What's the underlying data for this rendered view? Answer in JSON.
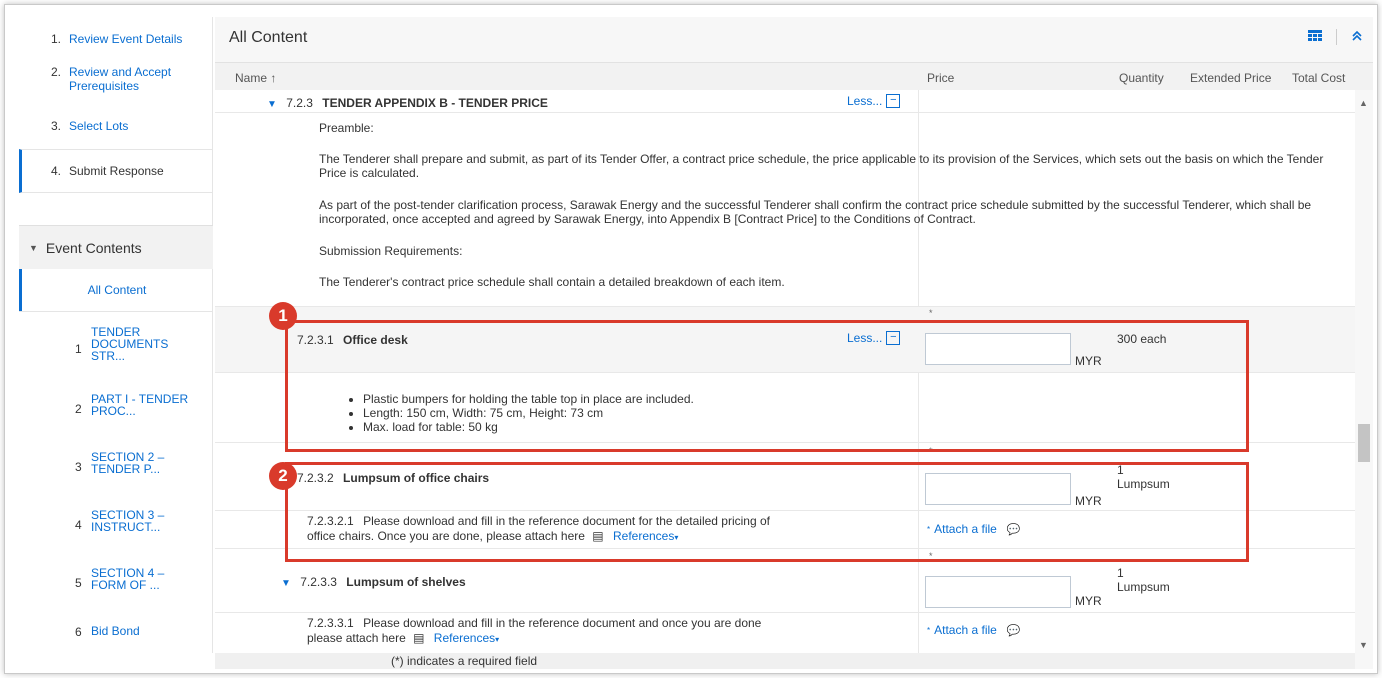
{
  "sidebar": {
    "steps": [
      {
        "num": "1.",
        "label": "Review Event Details"
      },
      {
        "num": "2.",
        "label": "Review and Accept Prerequisites"
      },
      {
        "num": "3.",
        "label": "Select Lots"
      },
      {
        "num": "4.",
        "label": "Submit Response"
      }
    ],
    "event_contents_label": "Event Contents",
    "all_content_label": "All Content",
    "items": [
      {
        "num": "1",
        "label": "TENDER DOCUMENTS STR..."
      },
      {
        "num": "2",
        "label": "PART I - TENDER PROC..."
      },
      {
        "num": "3",
        "label": "SECTION 2 – TENDER P..."
      },
      {
        "num": "4",
        "label": "SECTION 3 – INSTRUCT..."
      },
      {
        "num": "5",
        "label": "SECTION 4 – FORM OF ..."
      },
      {
        "num": "6",
        "label": "Bid Bond"
      }
    ]
  },
  "main": {
    "title": "All Content",
    "columns": {
      "name": "Name ↑",
      "price": "Price",
      "quantity": "Quantity",
      "extended_price": "Extended Price",
      "total_cost": "Total Cost"
    },
    "section": {
      "number": "7.2.3",
      "title": "TENDER APPENDIX B - TENDER PRICE",
      "less": "Less...",
      "preamble_label": "Preamble:",
      "para1": "The Tenderer shall prepare and submit, as part of its Tender Offer, a contract price schedule, the price applicable to its provision of the Services, which sets out the basis on which the Tender Price is calculated.",
      "para2": "As part of the post-tender clarification process, Sarawak Energy and the successful Tenderer shall confirm the contract price schedule submitted by the successful Tenderer, which shall be incorporated, once accepted and agreed by Sarawak Energy, into Appendix B [Contract Price] to the Conditions of Contract.",
      "submission_label": "Submission Requirements:",
      "para3": "The Tenderer's contract price schedule shall contain a detailed breakdown of each item."
    },
    "items": [
      {
        "number": "7.2.3.1",
        "title": "Office desk",
        "less": "Less...",
        "currency": "MYR",
        "quantity": "300 each",
        "bullets": [
          "Plastic bumpers for holding the table top in place are included.",
          "Length: 150 cm, Width: 75 cm, Height: 73 cm",
          "Max. load for table: 50 kg"
        ]
      },
      {
        "number": "7.2.3.2",
        "title": "Lumpsum of office chairs",
        "currency": "MYR",
        "qty_num": "1",
        "qty_unit": "Lumpsum",
        "sub_number": "7.2.3.2.1",
        "sub_line1": "Please download and fill in the reference document for the detailed pricing of",
        "sub_line2": "office chairs. Once you are done, please attach here",
        "references": "References",
        "attach": "Attach a file"
      },
      {
        "number": "7.2.3.3",
        "title": "Lumpsum of shelves",
        "currency": "MYR",
        "qty_num": "1",
        "qty_unit": "Lumpsum",
        "sub_number": "7.2.3.3.1",
        "sub_line1": "Please download and fill in the reference document and once you are done",
        "sub_line2": "please attach here",
        "references": "References",
        "attach": "Attach a file"
      }
    ],
    "required_note": "(*) indicates a required field"
  },
  "annotations": {
    "badge1": "1",
    "badge2": "2"
  },
  "colors": {
    "link_blue": "#0a6ed1",
    "annotation_red": "#d93a2b"
  }
}
